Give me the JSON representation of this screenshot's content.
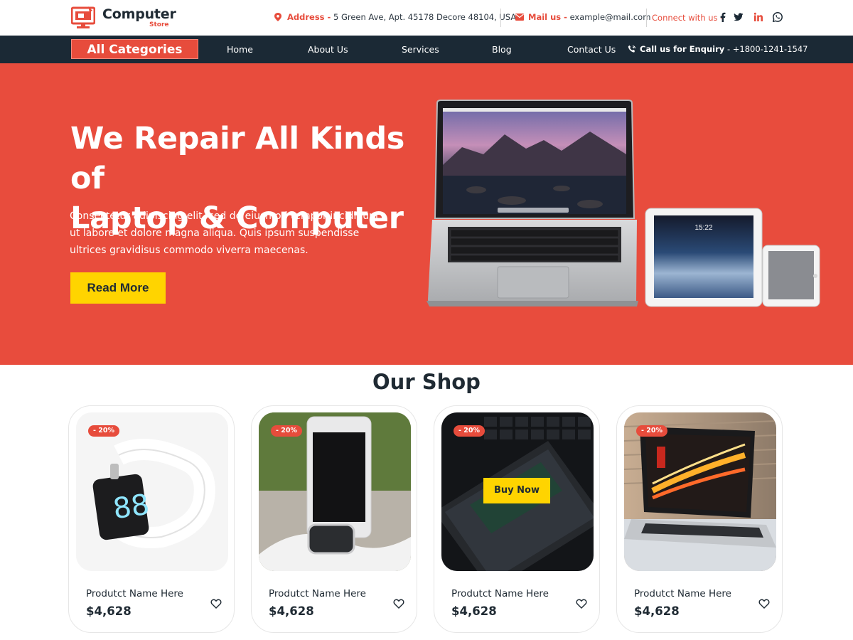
{
  "brand": {
    "name": "Computer",
    "sub": "Store"
  },
  "topbar": {
    "address_label": "Address -",
    "address_value": "5 Green Ave, Apt. 45178 Decore 48104, USA",
    "mail_label": "Mail us -",
    "mail_value": "example@mail.com",
    "connect_label": "Connect with us -",
    "social": [
      "facebook-icon",
      "twitter-icon",
      "linkedin-icon",
      "whatsapp-icon"
    ]
  },
  "nav": {
    "all_categories": "All Categories",
    "links": [
      "Home",
      "About Us",
      "Services",
      "Blog",
      "Contact Us"
    ],
    "enquiry_label": "Call us for Enquiry",
    "enquiry_value": "- +1800-1241-1547"
  },
  "hero": {
    "title_line1": "We Repair All Kinds of",
    "title_line2": "Laptop & Computer",
    "text": "Consectetur adipiscing elit, sed do eiusmod tempor incididunt ut labore et dolore magna aliqua. Quis ipsum suspendisse ultrices gravidisus commodo viverra maecenas.",
    "button": "Read More",
    "tablet_time": "15:22"
  },
  "shop": {
    "title": "Our Shop",
    "products": [
      {
        "badge": "- 20%",
        "name": "Produtct Name Here",
        "price": "$4,628",
        "image": "smartwatch-band"
      },
      {
        "badge": "- 20%",
        "name": "Produtct Name Here",
        "price": "$4,628",
        "image": "phone-and-watch"
      },
      {
        "badge": "- 20%",
        "name": "Produtct Name Here",
        "price": "$4,628",
        "image": "tablet-on-keyboard",
        "hover_button": "Buy Now"
      },
      {
        "badge": "- 20%",
        "name": "Produtct Name Here",
        "price": "$4,628",
        "image": "laptop-light-trails"
      }
    ]
  },
  "colors": {
    "accent": "#e84c3d",
    "dark": "#1b2935",
    "yellow": "#ffd400"
  }
}
